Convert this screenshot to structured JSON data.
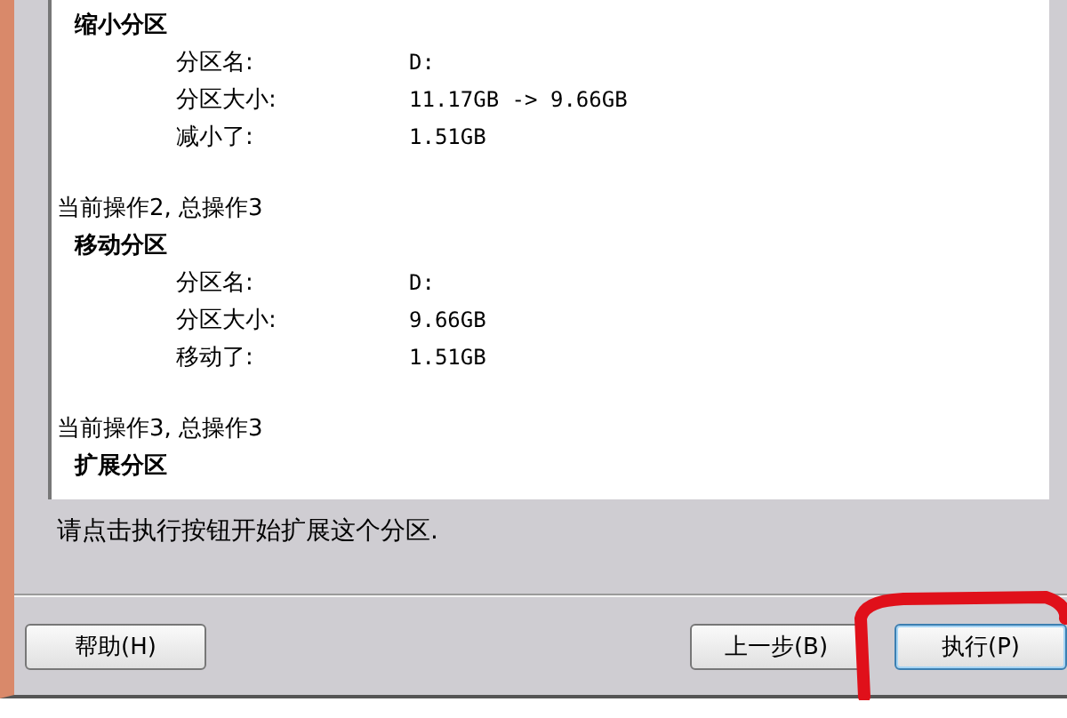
{
  "log": {
    "sections": [
      {
        "title": "缩小分区",
        "fields": [
          {
            "label": "分区名:",
            "value": "D:"
          },
          {
            "label": "分区大小:",
            "value": "11.17GB -> 9.66GB"
          },
          {
            "label": "减小了:",
            "value": "1.51GB"
          }
        ]
      },
      {
        "operation": "当前操作2, 总操作3",
        "title": "移动分区",
        "fields": [
          {
            "label": "分区名:",
            "value": "D:"
          },
          {
            "label": "分区大小:",
            "value": "9.66GB"
          },
          {
            "label": "移动了:",
            "value": "1.51GB"
          }
        ]
      },
      {
        "operation": "当前操作3, 总操作3",
        "title": "扩展分区"
      }
    ]
  },
  "instruction": "请点击执行按钮开始扩展这个分区.",
  "buttons": {
    "left": [
      {
        "label": "帮助(H)",
        "highlighted": false
      }
    ],
    "right": [
      {
        "label": "上一步(B)",
        "highlighted": false
      },
      {
        "label": "执行(P)",
        "highlighted": true
      }
    ]
  }
}
